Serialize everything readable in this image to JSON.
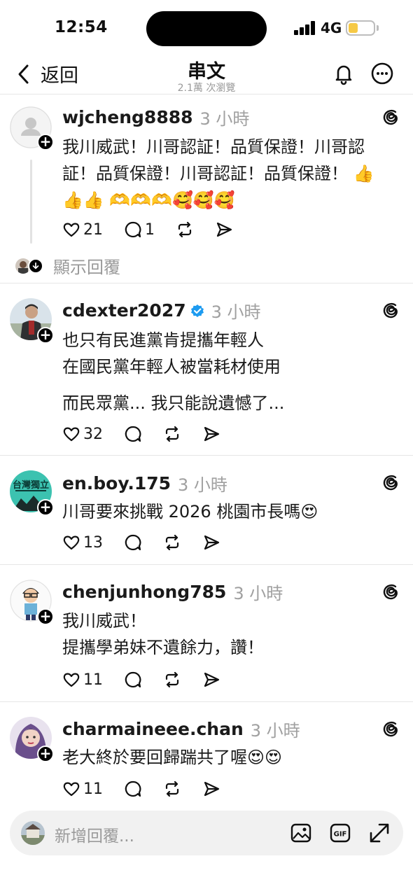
{
  "status_bar": {
    "time": "12:54",
    "network": "4G",
    "battery_percent": 30
  },
  "header": {
    "back_label": "返回",
    "title": "串文",
    "views": "2.1萬 次瀏覽"
  },
  "posts": [
    {
      "username": "wjcheng8888",
      "time": "3 小時",
      "verified": false,
      "text": "我川威武！川哥認証！品質保證！川哥認証！品質保證！川哥認証！品質保證！ 👍👍👍 🫶🫶🫶🥰🥰🥰",
      "likes": "21",
      "replies": "1",
      "show_replies_label": "顯示回覆"
    },
    {
      "username": "cdexter2027",
      "time": "3 小時",
      "verified": true,
      "text": "也只有民進黨肯提攜年輕人\n在國民黨年輕人被當耗材使用",
      "text2": "而民眾黨... 我只能說遺憾了...",
      "likes": "32",
      "replies": ""
    },
    {
      "username": "en.boy.175",
      "time": "3 小時",
      "verified": false,
      "avatar_text": "台灣獨立",
      "text": "川哥要來挑戰 2026 桃園市長嗎😍",
      "likes": "13",
      "replies": ""
    },
    {
      "username": "chenjunhong785",
      "time": "3 小時",
      "verified": false,
      "text": "我川威武！\n提攜學弟妹不遺餘力，讚！",
      "likes": "11",
      "replies": ""
    },
    {
      "username": "charmaineee.chan",
      "time": "3 小時",
      "verified": false,
      "text": "老大終於要回歸踹共了喔😍😍",
      "likes": "11",
      "replies": ""
    }
  ],
  "reply_bar": {
    "placeholder": "新增回覆..."
  },
  "icons": {
    "like": "heart-icon",
    "reply": "comment-icon",
    "repost": "repost-icon",
    "share": "send-icon",
    "threads": "threads-logo-icon",
    "notifications": "bell-icon",
    "more": "more-icon",
    "image": "image-icon",
    "gif": "gif-icon",
    "expand": "expand-icon"
  },
  "colors": {
    "verified": "#1d9bf0",
    "secondary_text": "#999999",
    "battery": "#f6c945"
  }
}
